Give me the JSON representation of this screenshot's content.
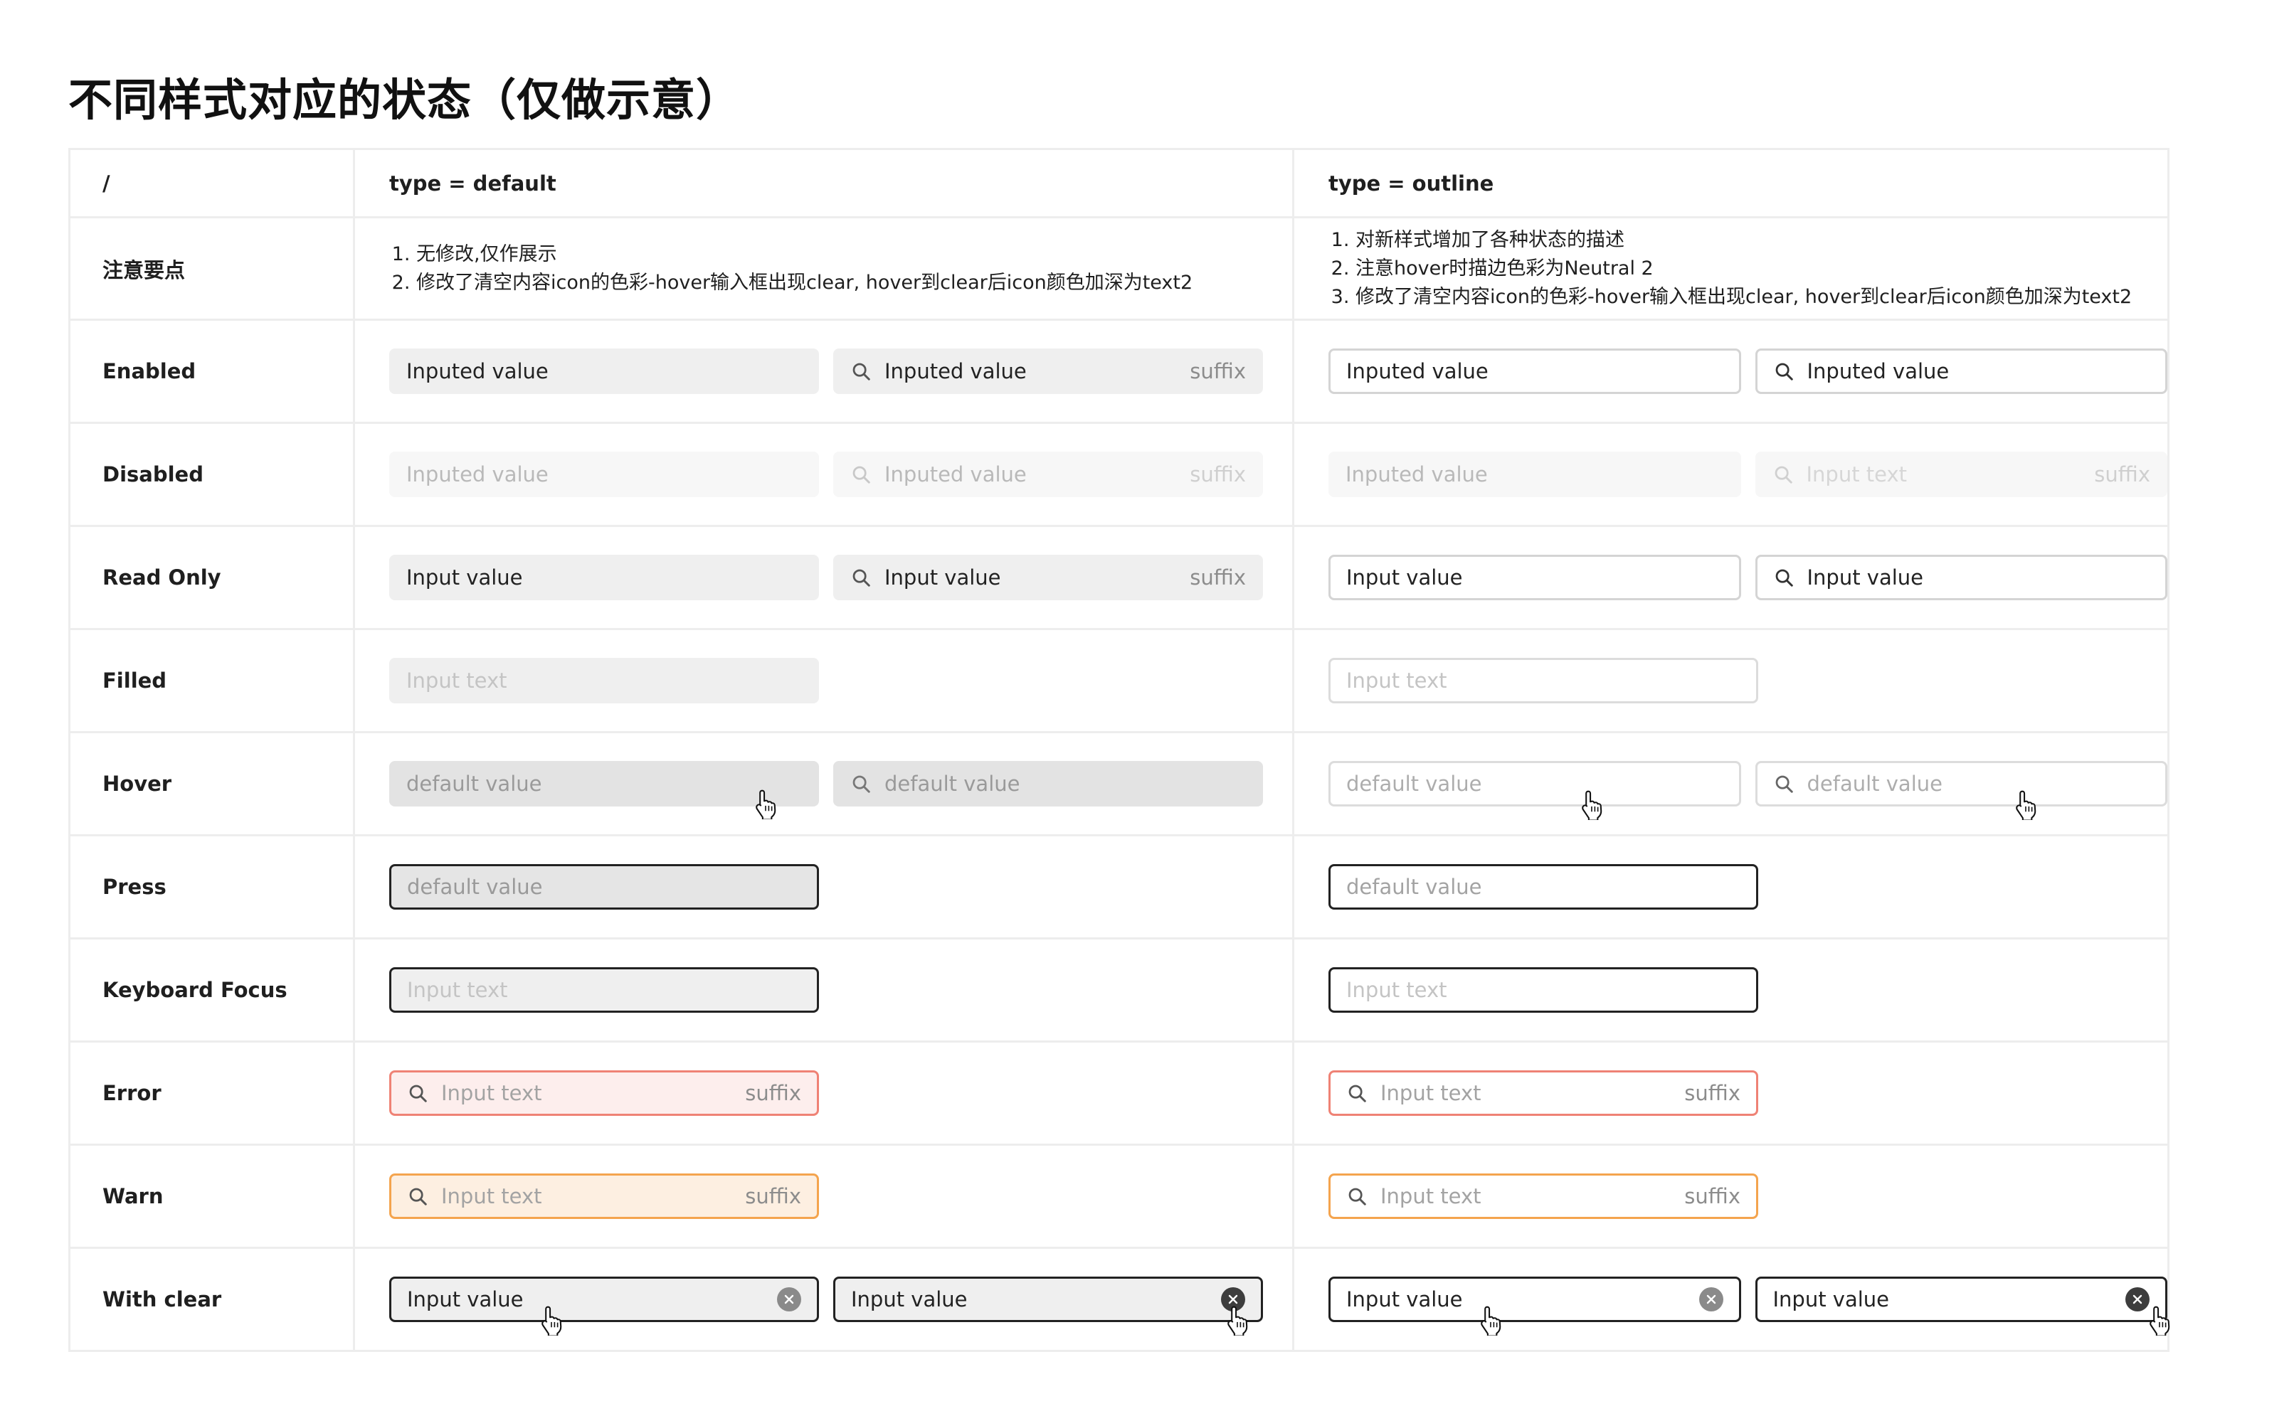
{
  "page_title": "不同样式对应的状态（仅做示意）",
  "header": {
    "corner": "/",
    "col_default": "type = default",
    "col_outline": "type = outline"
  },
  "notes": {
    "label": "注意要点",
    "default_items": [
      "无修改,仅作展示",
      "修改了清空内容icon的色彩-hover输入框出现clear, hover到clear后icon颜色加深为text2"
    ],
    "outline_items": [
      "对新样式增加了各种状态的描述",
      "注意hover时描边色彩为Neutral 2",
      "修改了清空内容icon的色彩-hover输入框出现clear, hover到clear后icon颜色加深为text2"
    ]
  },
  "rows": {
    "enabled": {
      "label": "Enabled",
      "default_plain": "Inputed value",
      "default_search": "Inputed value",
      "default_suffix": "suffix",
      "outline_plain": "Inputed value",
      "outline_search": "Inputed value"
    },
    "disabled": {
      "label": "Disabled",
      "default_plain": "Inputed value",
      "default_search": "Inputed value",
      "default_suffix": "suffix",
      "outline_plain": "Inputed value",
      "outline_search_placeholder": "Input text",
      "outline_suffix": "suffix"
    },
    "readonly": {
      "label": "Read Only",
      "default_plain": "Input value",
      "default_search": "Input value",
      "default_suffix": "suffix",
      "outline_plain": "Input value",
      "outline_search": "Input value"
    },
    "filled": {
      "label": "Filled",
      "default_placeholder": "Input text",
      "outline_placeholder": "Input text"
    },
    "hover": {
      "label": "Hover",
      "default_plain": "default value",
      "default_search": "default value",
      "outline_plain": "default value",
      "outline_search": "default value"
    },
    "press": {
      "label": "Press",
      "default_plain": "default value",
      "outline_plain": "default value"
    },
    "focus": {
      "label": "Keyboard Focus",
      "default_placeholder": "Input text",
      "outline_placeholder": "Input text"
    },
    "error": {
      "label": "Error",
      "default_placeholder": "Input text",
      "default_suffix": "suffix",
      "outline_placeholder": "Input text",
      "outline_suffix": "suffix"
    },
    "warn": {
      "label": "Warn",
      "default_placeholder": "Input text",
      "default_suffix": "suffix",
      "outline_placeholder": "Input text",
      "outline_suffix": "suffix"
    },
    "clear": {
      "label": "With clear",
      "default_a": "Input value",
      "default_b": "Input value",
      "outline_a": "Input value",
      "outline_b": "Input value"
    }
  },
  "colors": {
    "grid_line": "#ededed",
    "fill_bg": "#efefef",
    "disabled_bg": "#f7f7f7",
    "hover_bg": "#e3e3e3",
    "active_border": "#222222",
    "error_border": "#ef8275",
    "error_bg": "#fdeeed",
    "warn_border": "#f4a44e",
    "warn_bg": "#fdefe1",
    "outline_border": "#d4d4d4"
  },
  "icons": [
    "search-icon",
    "clear-icon",
    "pointer-cursor-icon"
  ]
}
